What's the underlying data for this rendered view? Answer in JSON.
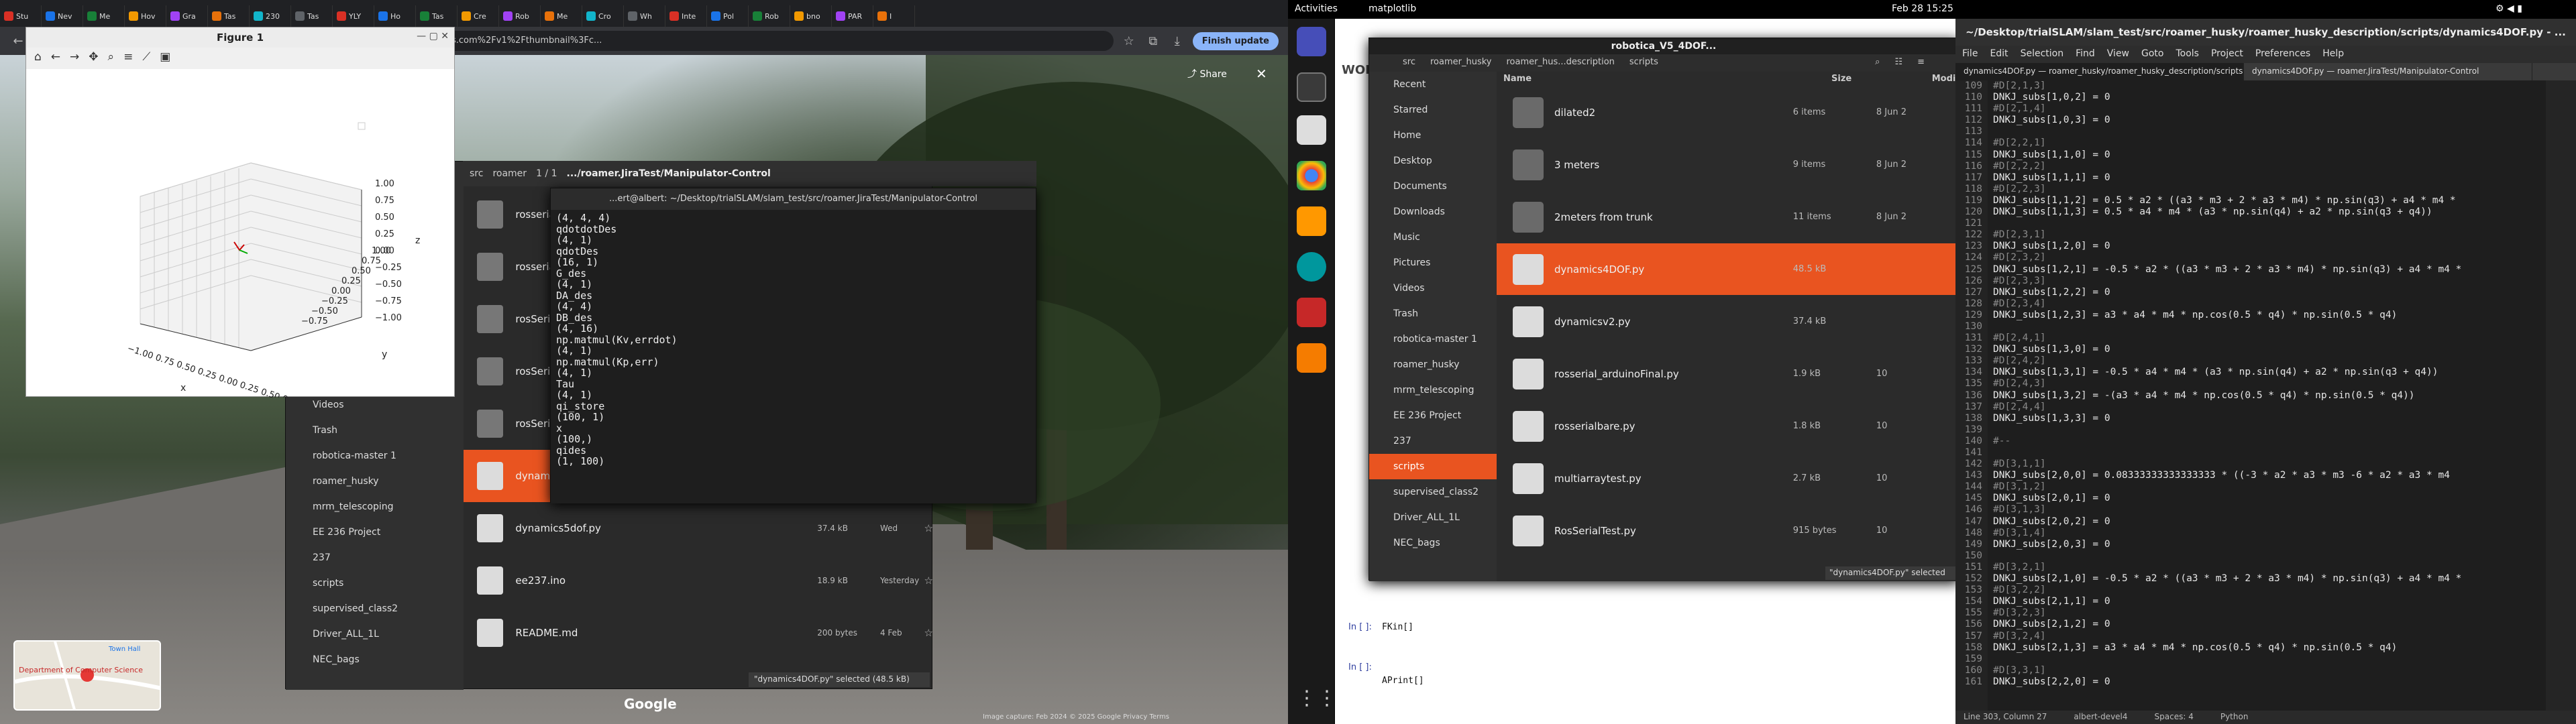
{
  "browser": {
    "tabs": [
      "Stu",
      "Nev",
      "Me",
      "Hov",
      "Gra",
      "Tas",
      "230",
      "Tas",
      "YLY",
      "Ho",
      "Tas",
      "Cre",
      "Rob",
      "Me",
      "Cro",
      "Wh",
      "Inte",
      "Pol",
      "Rob",
      "bno",
      "PAR",
      "I"
    ],
    "url": "m?1e1!3m5!1sse_-hG-gnvf1dG3ps4HtNwI2e0!6shttps:%2F%2Fstreetviewpixels-pa.googleapis.com%2Fv1%2Fthumbnail%3Fc...",
    "finish_update": "Finish update",
    "share": "Share",
    "google": "Google",
    "map_label": "Department of Computer Science",
    "map_town": "Town Hall",
    "copyright": "Image capture: Feb 2024   © 2025 Google   Privacy   Terms"
  },
  "figure": {
    "title": "Figure 1",
    "tools": [
      "home-icon",
      "back-icon",
      "forward-icon",
      "pan-icon",
      "zoom-icon",
      "configure-icon",
      "axes-icon",
      "save-icon"
    ],
    "z_ticks": [
      "1.00",
      "0.75",
      "0.50",
      "0.25",
      "0.00",
      "−0.25",
      "−0.50",
      "−0.75",
      "−1.00"
    ],
    "y_ticks": [
      "1.00",
      "0.75",
      "0.50",
      "0.25",
      "0.00",
      "−0.25",
      "−0.50",
      "−0.75"
    ],
    "x_ticks": "−1.00 0.75 0.50 0.25 0.00 0.25 0.50 0.75 1.00",
    "labels": {
      "x": "x",
      "y": "y",
      "z": "z"
    }
  },
  "nautilus_left": {
    "path": [
      "src",
      "roamer"
    ],
    "page": "1 / 1",
    "window_title": ".../roamer.JiraTest/Manipulator-Control",
    "sidebar": [
      "Videos",
      "Trash",
      "robotica-master 1",
      "roamer_husky",
      "mrm_telescoping",
      "EE 236 Project",
      "237",
      "scripts",
      "supervised_class2",
      "Driver_ALL_1L",
      "NEC_bags"
    ],
    "rows": [
      {
        "name": "rosserial_arduino",
        "size": "",
        "date": ""
      },
      {
        "name": "rosserial_arduino",
        "size": "",
        "date": ""
      },
      {
        "name": "rosSerialBare",
        "size": "",
        "date": ""
      },
      {
        "name": "rosSerialtest",
        "size": "",
        "date": ""
      },
      {
        "name": "rosSerialtest2",
        "size": "",
        "date": ""
      },
      {
        "name": "dynamics4DOF.py",
        "size": "",
        "date": ""
      },
      {
        "name": "dynamics5dof.py",
        "size": "37.4 kB",
        "date": "Wed"
      },
      {
        "name": "ee237.ino",
        "size": "18.9 kB",
        "date": "Yesterday"
      },
      {
        "name": "README.md",
        "size": "200 bytes",
        "date": "4 Feb"
      }
    ],
    "status": "\"dynamics4DOF.py\" selected (48.5 kB)"
  },
  "terminal": {
    "title": "...ert@albert: ~/Desktop/trialSLAM/slam_test/src/roamer.JiraTest/Manipulator-Control",
    "lines": [
      "(4, 4, 4)",
      "qdotdotDes",
      "(4, 1)",
      "qdotDes",
      "(16, 1)",
      "G_des",
      "(4, 1)",
      "DA_des",
      "(4, 4)",
      "DB_des",
      "(4, 16)",
      "np.matmul(Kv,errdot)",
      "(4, 1)",
      "np.matmul(Kp,err)",
      "(4, 1)",
      "Tau",
      "(4, 1)",
      "qi_store",
      "(100, 1)",
      "x",
      "(100,)",
      "qides",
      "(1, 100)",
      ""
    ]
  },
  "system": {
    "activities": "Activities",
    "app": "matplotlib",
    "clock": "Feb 28  15:25"
  },
  "files_right": {
    "title": "robotica_V5_4DOF...",
    "path": [
      "src",
      "roamer_husky",
      "roamer_hus...description",
      "scripts"
    ],
    "headers": {
      "name": "Name",
      "size": "Size",
      "modified": "Modif"
    },
    "sidebar": [
      "Recent",
      "Starred",
      "Home",
      "Desktop",
      "Documents",
      "Downloads",
      "Music",
      "Pictures",
      "Videos",
      "Trash",
      "robotica-master 1",
      "roamer_husky",
      "mrm_telescoping",
      "EE 236 Project",
      "237",
      "scripts",
      "supervised_class2",
      "Driver_ALL_1L",
      "NEC_bags"
    ],
    "selected_sidebar": "scripts",
    "rows": [
      {
        "name": "dilated2",
        "size": "6 items",
        "date": "8 Jun 2",
        "type": "folder"
      },
      {
        "name": "3 meters",
        "size": "9 items",
        "date": "8 Jun 2",
        "type": "folder"
      },
      {
        "name": "2meters from trunk",
        "size": "11 items",
        "date": "8 Jun 2",
        "type": "folder"
      },
      {
        "name": "dynamics4DOF.py",
        "size": "48.5 kB",
        "date": "",
        "type": "py"
      },
      {
        "name": "dynamicsv2.py",
        "size": "37.4 kB",
        "date": "",
        "type": "py"
      },
      {
        "name": "rosserial_arduinoFinal.py",
        "size": "1.9 kB",
        "date": "10",
        "type": "py"
      },
      {
        "name": "rosserialbare.py",
        "size": "1.8 kB",
        "date": "10",
        "type": "py"
      },
      {
        "name": "multiarraytest.py",
        "size": "2.7 kB",
        "date": "10",
        "type": "py"
      },
      {
        "name": "RosSerialTest.py",
        "size": "915 bytes",
        "date": "10",
        "type": "py"
      }
    ],
    "status": "\"dynamics4DOF.py\" selected"
  },
  "jupyter": {
    "cells": [
      "In [ ]:",
      "In [ ]:"
    ],
    "code": [
      "FKin[]",
      "APrint[]"
    ],
    "logo": "WOL"
  },
  "gedit": {
    "title": "~/Desktop/trialSLAM/slam_test/src/roamer_husky/roamer_husky_description/scripts/dynamics4DOF.py - ...",
    "menu": [
      "File",
      "Edit",
      "Selection",
      "Find",
      "View",
      "Goto",
      "Tools",
      "Project",
      "Preferences",
      "Help"
    ],
    "tabs": [
      "dynamics4DOF.py — roamer_husky/roamer_husky_description/scripts",
      "dynamics4DOF.py — roamer.JiraTest/Manipulator-Control"
    ],
    "start_line": 109,
    "code": [
      "#D[2,1,3]",
      "DNKJ_subs[1,0,2] = 0",
      "#D[2,1,4]",
      "DNKJ_subs[1,0,3] = 0",
      "",
      "#D[2,2,1]",
      "DNKJ_subs[1,1,0] = 0",
      "#D[2,2,2]",
      "DNKJ_subs[1,1,1] = 0",
      "#D[2,2,3]",
      "DNKJ_subs[1,1,2] = 0.5 * a2 * ((a3 * m3 + 2 * a3 * m4) * np.sin(q3) + a4 * m4 *",
      "DNKJ_subs[1,1,3] = 0.5 * a4 * m4 * (a3 * np.sin(q4) + a2 * np.sin(q3 + q4))",
      "",
      "#D[2,3,1]",
      "DNKJ_subs[1,2,0] = 0",
      "#D[2,3,2]",
      "DNKJ_subs[1,2,1] = -0.5 * a2 * ((a3 * m3 + 2 * a3 * m4) * np.sin(q3) + a4 * m4 *",
      "#D[2,3,3]",
      "DNKJ_subs[1,2,2] = 0",
      "#D[2,3,4]",
      "DNKJ_subs[1,2,3] = a3 * a4 * m4 * np.cos(0.5 * q4) * np.sin(0.5 * q4)",
      "",
      "#D[2,4,1]",
      "DNKJ_subs[1,3,0] = 0",
      "#D[2,4,2]",
      "DNKJ_subs[1,3,1] = -0.5 * a4 * m4 * (a3 * np.sin(q4) + a2 * np.sin(q3 + q4))",
      "#D[2,4,3]",
      "DNKJ_subs[1,3,2] = -(a3 * a4 * m4 * np.cos(0.5 * q4) * np.sin(0.5 * q4))",
      "#D[2,4,4]",
      "DNKJ_subs[1,3,3] = 0",
      "",
      "#--",
      "",
      "#D[3,1,1]",
      "DNKJ_subs[2,0,0] = 0.08333333333333333 * ((-3 * a2 * a3 * m3 -6 * a2 * a3 * m4",
      "#D[3,1,2]",
      "DNKJ_subs[2,0,1] = 0",
      "#D[3,1,3]",
      "DNKJ_subs[2,0,2] = 0",
      "#D[3,1,4]",
      "DNKJ_subs[2,0,3] = 0",
      "",
      "#D[3,2,1]",
      "DNKJ_subs[2,1,0] = -0.5 * a2 * ((a3 * m3 + 2 * a3 * m4) * np.sin(q3) + a4 * m4 *",
      "#D[3,2,2]",
      "DNKJ_subs[2,1,1] = 0",
      "#D[3,2,3]",
      "DNKJ_subs[2,1,2] = 0",
      "#D[3,2,4]",
      "DNKJ_subs[2,1,3] = a3 * a4 * m4 * np.cos(0.5 * q4) * np.sin(0.5 * q4)",
      "",
      "#D[3,3,1]",
      "DNKJ_subs[2,2,0] = 0"
    ],
    "status": [
      "Line 303, Column 27",
      "albert-devel4",
      "Spaces: 4",
      "Python"
    ]
  },
  "colors": {
    "ubuntu_orange": "#e95420",
    "chrome_dark": "#202124",
    "terminal_bg": "#1e1e1e"
  }
}
